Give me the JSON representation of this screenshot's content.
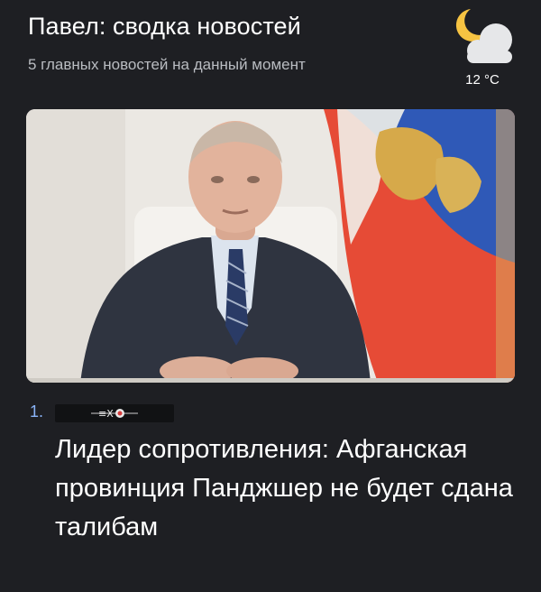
{
  "header": {
    "title": "Павел: сводка новостей",
    "subtitle": "5 главных новостей на данный момент"
  },
  "weather": {
    "icon": "moon-cloud-icon",
    "temperature": "12 °C"
  },
  "news": {
    "index": "1.",
    "source_logo_icon": "ekho-moskvy-logo",
    "image_icon": "news-photo",
    "headline": "Лидер сопротивления: Афганская провинция Панджшер не будет сдана талибам"
  },
  "colors": {
    "background": "#1e1f23",
    "accent": "#8ab4f8",
    "moon": "#f6c342",
    "cloud": "#e6e7e9",
    "subtitle": "#b9bcc1"
  }
}
